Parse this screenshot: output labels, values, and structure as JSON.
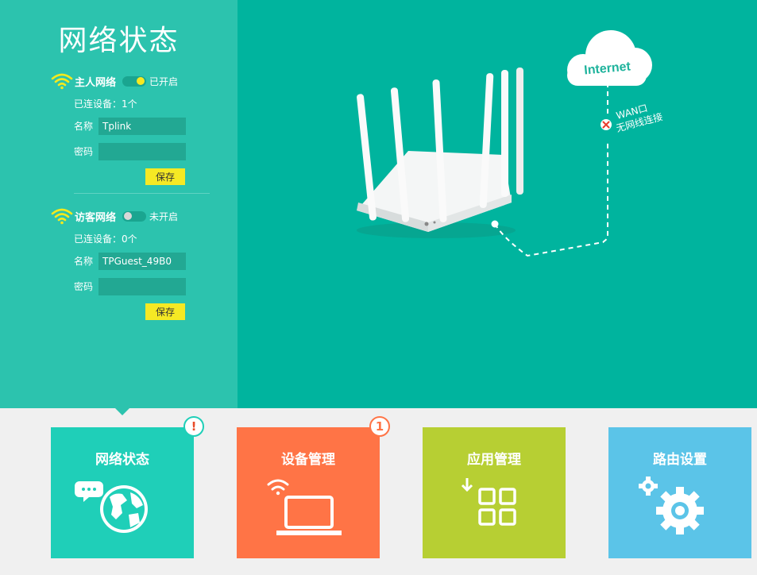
{
  "page": {
    "title": "网络状态"
  },
  "main_network": {
    "name": "主人网络",
    "status": "已开启",
    "enabled": true,
    "connected": "已连设备：1个",
    "name_label": "名称",
    "ssid": "Tplink",
    "password_label": "密码",
    "password": "",
    "save_label": "保存"
  },
  "guest_network": {
    "name": "访客网络",
    "status": "未开启",
    "enabled": false,
    "connected": "已连设备：0个",
    "name_label": "名称",
    "ssid": "TPGuest_49B0",
    "password_label": "密码",
    "password": "",
    "save_label": "保存"
  },
  "diagram": {
    "cloud_label": "Internet",
    "wan_label": "WAN口",
    "wan_status": "无网线连接"
  },
  "nav": [
    {
      "label": "网络状态",
      "color": "#1fcfb8",
      "badge": "!",
      "badge_color": "#e94b2a",
      "badge_border": "#1fcfb8",
      "icon": "globe-chat-icon"
    },
    {
      "label": "设备管理",
      "color": "#ff7446",
      "badge": "1",
      "badge_color": "#ff7446",
      "badge_border": "#ff7446",
      "icon": "laptop-wifi-icon"
    },
    {
      "label": "应用管理",
      "color": "#b7cf33",
      "badge": "",
      "icon": "app-grid-icon"
    },
    {
      "label": "路由设置",
      "color": "#5bc4e8",
      "badge": "",
      "icon": "gears-icon"
    }
  ]
}
